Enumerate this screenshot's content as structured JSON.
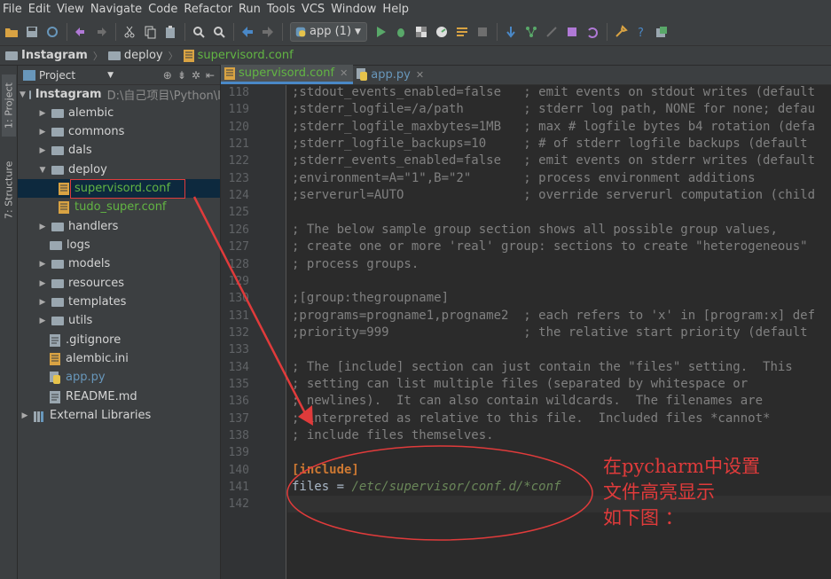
{
  "menu": [
    "File",
    "Edit",
    "View",
    "Navigate",
    "Code",
    "Refactor",
    "Run",
    "Tools",
    "VCS",
    "Window",
    "Help"
  ],
  "toolbar": {
    "run_config": "app (1)",
    "icons": [
      "open-icon",
      "save-icon",
      "sync-icon",
      "undo-icon",
      "redo-icon",
      "cut-icon",
      "copy-icon",
      "paste-icon",
      "find-icon",
      "replace-icon",
      "back-icon",
      "forward-icon",
      "run-icon",
      "debug-icon",
      "coverage-icon",
      "profile-icon",
      "concurrency-icon",
      "stop-icon",
      "vcs-update-icon",
      "vcs-commit-icon",
      "vcs-compare-icon",
      "vcs-history-icon",
      "vcs-revert-icon",
      "settings-icon",
      "help-icon",
      "sdk-icon"
    ]
  },
  "breadcrumb": [
    "Instagram",
    "deploy",
    "supervisord.conf"
  ],
  "side_tabs": {
    "project": "1: Project",
    "structure": "7: Structure"
  },
  "project_panel": {
    "title": "Project",
    "tree": [
      {
        "label": "Instagram",
        "path": "D:\\自己项目\\Python\\I",
        "type": "root",
        "expanded": true
      },
      {
        "label": "alembic",
        "type": "folder"
      },
      {
        "label": "commons",
        "type": "folder"
      },
      {
        "label": "dals",
        "type": "folder"
      },
      {
        "label": "deploy",
        "type": "folder",
        "expanded": true
      },
      {
        "label": "supervisord.conf",
        "type": "file-conf",
        "selected": true
      },
      {
        "label": "tudo_super.conf",
        "type": "file-conf"
      },
      {
        "label": "handlers",
        "type": "folder"
      },
      {
        "label": "logs",
        "type": "folder-leaf"
      },
      {
        "label": "models",
        "type": "folder"
      },
      {
        "label": "resources",
        "type": "folder"
      },
      {
        "label": "templates",
        "type": "folder"
      },
      {
        "label": "utils",
        "type": "folder"
      },
      {
        "label": ".gitignore",
        "type": "file"
      },
      {
        "label": "alembic.ini",
        "type": "file-conf-plain"
      },
      {
        "label": "app.py",
        "type": "file-py"
      },
      {
        "label": "README.md",
        "type": "file"
      },
      {
        "label": "External Libraries",
        "type": "libs"
      }
    ]
  },
  "editor": {
    "tabs": [
      {
        "label": "supervisord.conf",
        "active": true
      },
      {
        "label": "app.py",
        "active": false
      }
    ],
    "lines": [
      {
        "n": "118",
        "text": ";stdout_events_enabled=false   ; emit events on stdout writes (default"
      },
      {
        "n": "119",
        "text": ";stderr_logfile=/a/path        ; stderr log path, NONE for none; defau"
      },
      {
        "n": "120",
        "text": ";stderr_logfile_maxbytes=1MB   ; max # logfile bytes b4 rotation (defa"
      },
      {
        "n": "121",
        "text": ";stderr_logfile_backups=10     ; # of stderr logfile backups (default"
      },
      {
        "n": "122",
        "text": ";stderr_events_enabled=false   ; emit events on stderr writes (default"
      },
      {
        "n": "123",
        "text": ";environment=A=\"1\",B=\"2\"       ; process environment additions"
      },
      {
        "n": "124",
        "text": ";serverurl=AUTO                ; override serverurl computation (child"
      },
      {
        "n": "125",
        "text": ""
      },
      {
        "n": "126",
        "text": "; The below sample group section shows all possible group values,"
      },
      {
        "n": "127",
        "text": "; create one or more 'real' group: sections to create \"heterogeneous\""
      },
      {
        "n": "128",
        "text": "; process groups."
      },
      {
        "n": "129",
        "text": ""
      },
      {
        "n": "130",
        "text": ";[group:thegroupname]"
      },
      {
        "n": "131",
        "text": ";programs=progname1,progname2  ; each refers to 'x' in [program:x] def"
      },
      {
        "n": "132",
        "text": ";priority=999                  ; the relative start priority (default"
      },
      {
        "n": "133",
        "text": ""
      },
      {
        "n": "134",
        "text": "; The [include] section can just contain the \"files\" setting.  This"
      },
      {
        "n": "135",
        "text": "; setting can list multiple files (separated by whitespace or"
      },
      {
        "n": "136",
        "text": "; newlines).  It can also contain wildcards.  The filenames are"
      },
      {
        "n": "137",
        "text": "; interpreted as relative to this file.  Included files *cannot*"
      },
      {
        "n": "138",
        "text": "; include files themselves."
      },
      {
        "n": "139",
        "text": ""
      },
      {
        "n": "140",
        "text": "[include]",
        "kind": "section"
      },
      {
        "n": "141",
        "key": "files = ",
        "value": "/etc/supervisor/conf.d/*conf",
        "kind": "kv"
      },
      {
        "n": "142",
        "text": ""
      }
    ]
  },
  "annotation": {
    "lines": [
      "在pycharm中设置",
      "文件高亮显示",
      "如下图 ："
    ],
    "color": "#e03b3b"
  }
}
